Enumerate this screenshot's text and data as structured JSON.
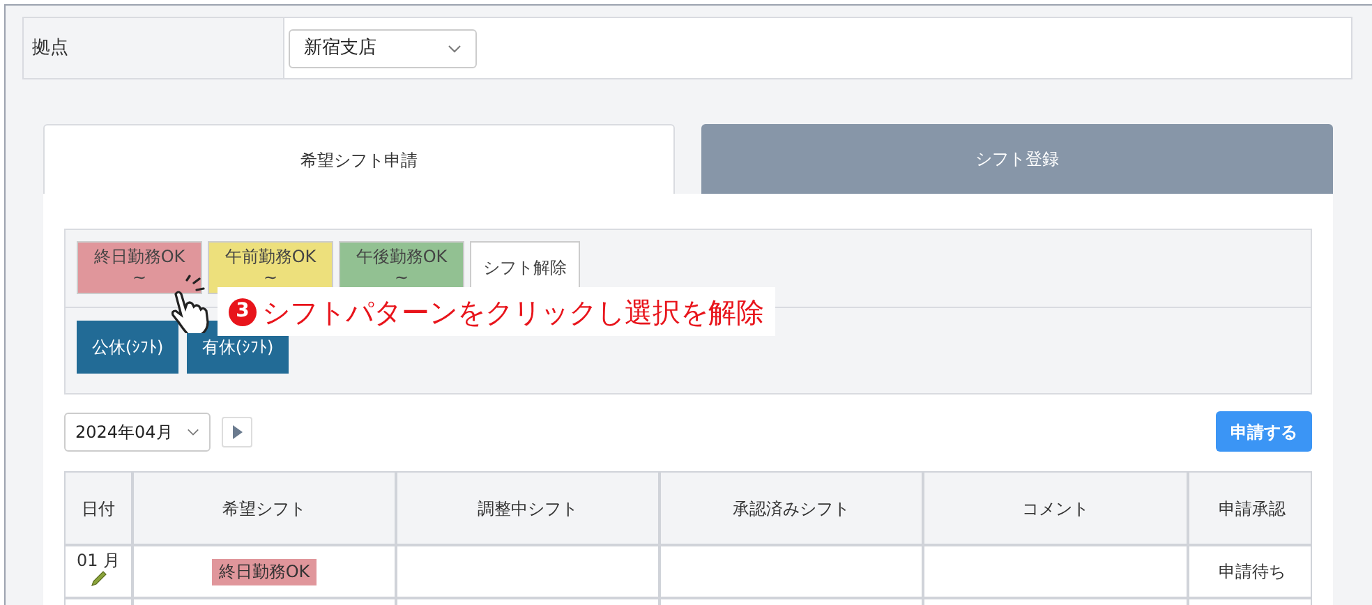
{
  "location": {
    "label": "拠点",
    "value": "新宿支店"
  },
  "tabs": [
    {
      "label": "希望シフト申請",
      "selected": true
    },
    {
      "label": "シフト登録",
      "selected": false
    }
  ],
  "patterns": [
    {
      "kind": "shift",
      "label": "終日勤務OK",
      "sub": "~",
      "color": "#e0969b"
    },
    {
      "kind": "shift",
      "label": "午前勤務OK",
      "sub": "~",
      "color": "#ede07c"
    },
    {
      "kind": "shift",
      "label": "午後勤務OK",
      "sub": "~",
      "color": "#92c192"
    },
    {
      "kind": "clear",
      "label": "シフト解除"
    }
  ],
  "holidays": [
    {
      "label": "公休(ｼﾌﾄ)"
    },
    {
      "label": "有休(ｼﾌﾄ)"
    }
  ],
  "callout": {
    "step": "3",
    "text": "シフトパターンをクリックし選択を解除"
  },
  "month": {
    "value": "2024年04月"
  },
  "submit": "申請する",
  "table": {
    "columns": [
      "日付",
      "希望シフト",
      "調整中シフト",
      "承認済みシフト",
      "コメント",
      "申請承認"
    ],
    "rows": [
      {
        "date": "01 月",
        "wish": {
          "label": "終日勤務OK",
          "color": "#e0969b"
        },
        "status": "申請待ち"
      }
    ]
  }
}
